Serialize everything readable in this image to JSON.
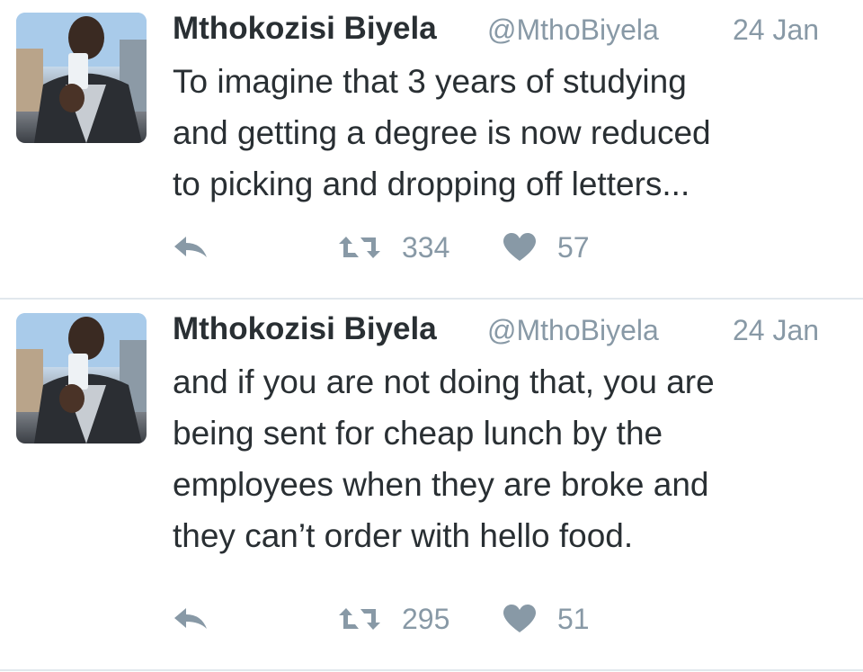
{
  "tweets": [
    {
      "author_name": "Mthokozisi Biyela",
      "author_handle": "@MthoBiyela",
      "time": "24 Jan",
      "text": "To imagine that 3 years of studying\nand getting a degree is now reduced\nto picking and dropping off letters...",
      "retweets": "334",
      "likes": "57"
    },
    {
      "author_name": "Mthokozisi Biyela",
      "author_handle": "@MthoBiyela",
      "time": "24 Jan",
      "text": "and if you are not doing that, you are\nbeing sent for cheap lunch by the\nemployees when they are broke and\nthey can’t order with hello food.",
      "retweets": "295",
      "likes": "51"
    }
  ],
  "icons": {
    "reply": "reply-icon",
    "retweet": "retweet-icon",
    "like": "heart-icon"
  },
  "colors": {
    "text": "#292f33",
    "muted": "#8899a6",
    "divider": "#e1e8ed"
  }
}
